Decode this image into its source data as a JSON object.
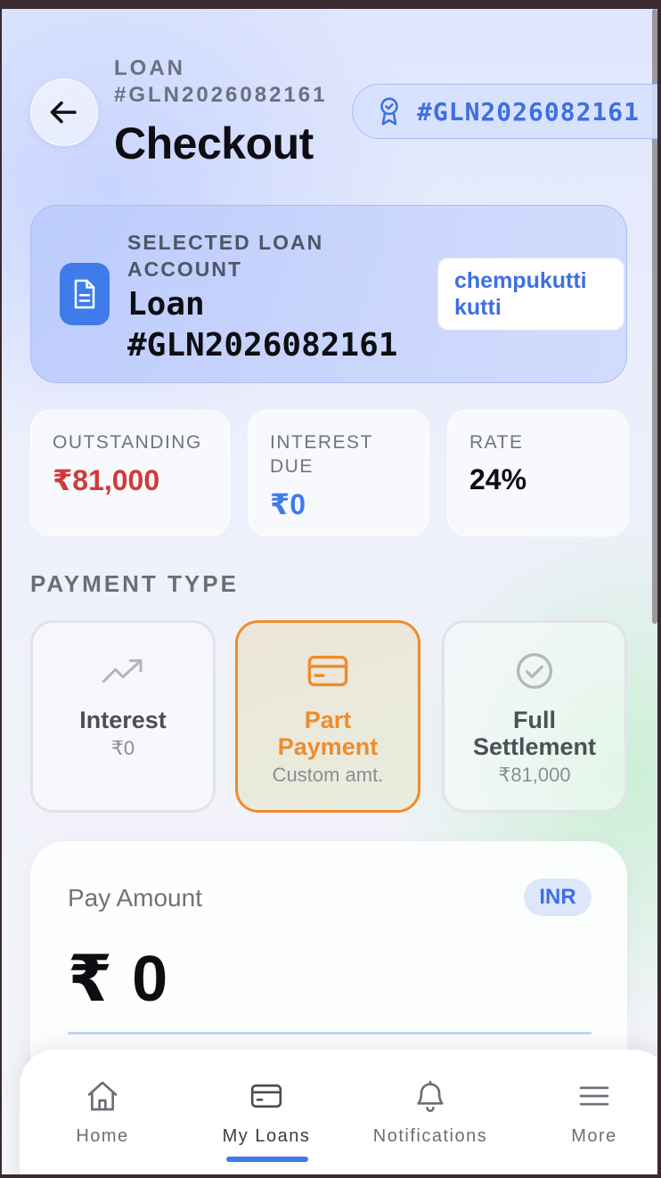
{
  "header": {
    "eyebrow": "LOAN #GLN2026082161",
    "title": "Checkout",
    "badge": "#GLN2026082161"
  },
  "loan_card": {
    "label": "SELECTED LOAN ACCOUNT",
    "number": "Loan #GLN2026082161",
    "customer": "chempukutti kutti"
  },
  "stats": [
    {
      "label": "OUTSTANDING",
      "value": "₹81,000",
      "color": "#d13a3a"
    },
    {
      "label": "INTEREST DUE",
      "value": "₹0",
      "color": "#3f7be9"
    },
    {
      "label": "RATE",
      "value": "24%",
      "color": "#0d0d12"
    }
  ],
  "payment_type": {
    "title": "PAYMENT TYPE",
    "options": [
      {
        "icon": "trend-up-icon",
        "name": "Interest",
        "sub": "₹0",
        "selected": false
      },
      {
        "icon": "card-icon",
        "name": "Part Payment",
        "sub": "Custom amt.",
        "selected": true
      },
      {
        "icon": "check-circle-icon",
        "name": "Full Settlement",
        "sub": "₹81,000",
        "selected": false
      }
    ]
  },
  "amount": {
    "label": "Pay Amount",
    "currency": "INR",
    "symbol": "₹",
    "value": "0"
  },
  "nav": {
    "items": [
      {
        "icon": "home-icon",
        "label": "Home",
        "active": false
      },
      {
        "icon": "wallet-icon",
        "label": "My Loans",
        "active": true
      },
      {
        "icon": "bell-icon",
        "label": "Notifications",
        "active": false
      },
      {
        "icon": "menu-icon",
        "label": "More",
        "active": false
      }
    ]
  },
  "colors": {
    "accent": "#3f7be9",
    "selected": "#ee8c2e"
  }
}
